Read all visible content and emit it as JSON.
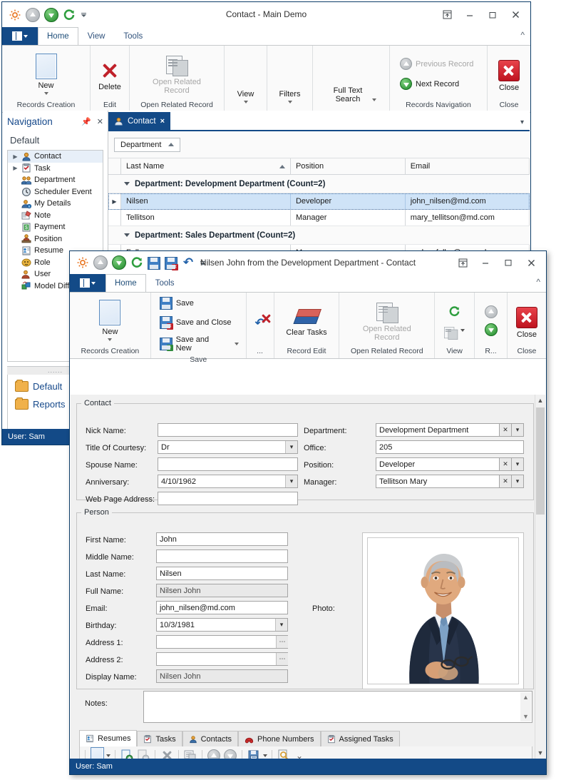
{
  "colors": {
    "accent": "#134a87",
    "titlebar_text": "#303030",
    "tab_active": "#1f4e79",
    "status_bar": "#134a87",
    "close_red": "#bf1420",
    "link_blue": "#15488a"
  },
  "window_main": {
    "title": "Contact - Main Demo",
    "quick_access": [
      "gear-icon",
      "previous-record-icon",
      "next-record-icon",
      "refresh-icon",
      "qat-dropdown-icon"
    ],
    "window_buttons": [
      "restore-ribbon-icon",
      "minimize-icon",
      "maximize-icon",
      "close-icon"
    ],
    "app_menu_label": "",
    "tabs": [
      {
        "label": "Home",
        "selected": true
      },
      {
        "label": "View",
        "selected": false
      },
      {
        "label": "Tools",
        "selected": false
      }
    ],
    "ribbon_groups": [
      {
        "label": "Records Creation",
        "items": [
          {
            "label": "New",
            "icon": "new-document-icon",
            "disabled": false,
            "has_dropdown": true
          }
        ]
      },
      {
        "label": "Edit",
        "items": [
          {
            "label": "Delete",
            "icon": "delete-x-icon",
            "disabled": false,
            "has_dropdown": false
          }
        ]
      },
      {
        "label": "Open Related Record",
        "items": [
          {
            "label": "Open Related Record",
            "icon": "open-related-record-icon",
            "disabled": true,
            "has_dropdown": false
          }
        ]
      },
      {
        "label": "",
        "items": [
          {
            "label": "View",
            "icon": "",
            "disabled": false,
            "has_dropdown": true
          }
        ]
      },
      {
        "label": "",
        "items": [
          {
            "label": "Filters",
            "icon": "",
            "disabled": false,
            "has_dropdown": true
          }
        ]
      },
      {
        "label": "",
        "items": [
          {
            "label": "Full Text Search",
            "icon": "",
            "disabled": false,
            "has_dropdown": true
          }
        ]
      },
      {
        "label": "Records Navigation",
        "items": [
          {
            "label": "Previous Record",
            "icon": "previous-record-icon",
            "disabled": true,
            "has_dropdown": false
          },
          {
            "label": "Next Record",
            "icon": "next-record-icon",
            "disabled": false,
            "has_dropdown": false
          }
        ]
      },
      {
        "label": "Close",
        "items": [
          {
            "label": "Close",
            "icon": "close-red-icon",
            "disabled": false,
            "has_dropdown": false
          }
        ]
      }
    ],
    "navigation": {
      "title": "Navigation",
      "pin_icon": "pin-icon",
      "close_icon": "close-icon",
      "section": "Default",
      "items": [
        {
          "label": "Contact",
          "icon": "contact-icon",
          "expandable": true,
          "selected": true
        },
        {
          "label": "Task",
          "icon": "task-icon",
          "expandable": true,
          "selected": false
        },
        {
          "label": "Department",
          "icon": "department-icon",
          "expandable": false,
          "selected": false
        },
        {
          "label": "Scheduler Event",
          "icon": "scheduler-event-icon",
          "expandable": false,
          "selected": false
        },
        {
          "label": "My Details",
          "icon": "my-details-icon",
          "expandable": false,
          "selected": false
        },
        {
          "label": "Note",
          "icon": "note-icon",
          "expandable": false,
          "selected": false
        },
        {
          "label": "Payment",
          "icon": "payment-icon",
          "expandable": false,
          "selected": false
        },
        {
          "label": "Position",
          "icon": "position-icon",
          "expandable": false,
          "selected": false
        },
        {
          "label": "Resume",
          "icon": "resume-icon",
          "expandable": false,
          "selected": false
        },
        {
          "label": "Role",
          "icon": "role-icon",
          "expandable": false,
          "selected": false
        },
        {
          "label": "User",
          "icon": "user-icon",
          "expandable": false,
          "selected": false
        },
        {
          "label": "Model Diff",
          "icon": "model-difference-icon",
          "expandable": false,
          "selected": false
        }
      ],
      "groups": [
        {
          "label": "Default",
          "icon": "folder-icon"
        },
        {
          "label": "Reports",
          "icon": "folder-icon"
        }
      ]
    },
    "document_tab": {
      "label": "Contact",
      "icon": "contact-icon",
      "close": "×",
      "overflow": "▾"
    },
    "group_panel": {
      "chip": "Department",
      "sort": "ascending"
    },
    "grid": {
      "columns": [
        "Last Name",
        "Position",
        "Email"
      ],
      "sorted_column": "Last Name",
      "sort_direction": "ascending",
      "rows": [
        {
          "type": "group",
          "label": "Department: Development Department (Count=2)"
        },
        {
          "type": "data",
          "selected": true,
          "cells": [
            "Nilsen",
            "Developer",
            "john_nilsen@md.com"
          ]
        },
        {
          "type": "data",
          "selected": false,
          "cells": [
            "Tellitson",
            "Manager",
            "mary_tellitson@md.com"
          ]
        },
        {
          "type": "group",
          "label": "Department: Sales Department (Count=2)"
        },
        {
          "type": "data",
          "selected": false,
          "cells": [
            "Fuller",
            "Manager",
            "andrewfuller@example.com"
          ]
        }
      ]
    },
    "status_bar": "User: Sam"
  },
  "window_detail": {
    "title": "Nilsen John from the Development Department - Contact",
    "quick_access": [
      "gear-icon",
      "previous-record-icon",
      "next-record-icon",
      "refresh-icon",
      "save-icon",
      "save-and-close-icon",
      "undo-icon",
      "qat-dropdown-icon"
    ],
    "window_buttons": [
      "restore-ribbon-icon",
      "minimize-icon",
      "maximize-icon",
      "close-icon"
    ],
    "tabs": [
      {
        "label": "Home",
        "selected": true
      },
      {
        "label": "Tools",
        "selected": false
      }
    ],
    "ribbon_groups": [
      {
        "label": "Records Creation",
        "items": [
          {
            "label": "New",
            "icon": "new-document-icon",
            "disabled": false,
            "has_dropdown": true
          }
        ]
      },
      {
        "label": "Save",
        "items": [
          {
            "label": "Save",
            "icon": "save-icon",
            "disabled": false,
            "has_dropdown": false
          },
          {
            "label": "Save and Close",
            "icon": "save-and-close-icon",
            "disabled": false,
            "has_dropdown": false
          },
          {
            "label": "Save and New",
            "icon": "save-and-new-icon",
            "disabled": false,
            "has_dropdown": true
          }
        ]
      },
      {
        "label": "...",
        "items": [
          {
            "label": "Delete",
            "icon": "delete-x-icon",
            "disabled": false,
            "has_dropdown": false
          },
          {
            "label": "Undo",
            "icon": "undo-icon",
            "disabled": false,
            "has_dropdown": false
          }
        ]
      },
      {
        "label": "Record Edit",
        "items": [
          {
            "label": "Clear Tasks",
            "icon": "eraser-icon",
            "disabled": false,
            "has_dropdown": false
          }
        ]
      },
      {
        "label": "Open Related Record",
        "items": [
          {
            "label": "Open Related Record",
            "icon": "open-related-record-icon",
            "disabled": true,
            "has_dropdown": false
          }
        ]
      },
      {
        "label": "View",
        "items": [
          {
            "label": "Refresh",
            "icon": "refresh-icon",
            "disabled": false,
            "has_dropdown": false
          },
          {
            "label": "Show Layout",
            "icon": "layout-icon",
            "disabled": true,
            "has_dropdown": true
          }
        ]
      },
      {
        "label": "R...",
        "items": [
          {
            "label": "Previous Record",
            "icon": "previous-record-icon",
            "disabled": true,
            "has_dropdown": false
          },
          {
            "label": "Next Record",
            "icon": "next-record-icon",
            "disabled": false,
            "has_dropdown": false
          }
        ]
      },
      {
        "label": "Close",
        "items": [
          {
            "label": "Close",
            "icon": "close-red-icon",
            "disabled": false,
            "has_dropdown": false
          }
        ]
      }
    ],
    "contact_group": {
      "legend": "Contact",
      "fields_left": [
        {
          "label": "Nick Name:",
          "value": "",
          "type": "text"
        },
        {
          "label": "Title Of Courtesy:",
          "value": "Dr",
          "type": "combo"
        },
        {
          "label": "Spouse Name:",
          "value": "",
          "type": "text"
        },
        {
          "label": "Anniversary:",
          "value": "4/10/1962",
          "type": "combo"
        },
        {
          "label": "Web Page Address:",
          "value": "",
          "type": "text"
        }
      ],
      "fields_right": [
        {
          "label": "Department:",
          "value": "Development Department",
          "type": "lookup"
        },
        {
          "label": "Office:",
          "value": "205",
          "type": "text"
        },
        {
          "label": "Position:",
          "value": "Developer",
          "type": "lookup"
        },
        {
          "label": "Manager:",
          "value": "Tellitson Mary",
          "type": "lookup"
        }
      ]
    },
    "person_group": {
      "legend": "Person",
      "fields": [
        {
          "label": "First Name:",
          "value": "John",
          "type": "text",
          "readonly": false
        },
        {
          "label": "Middle Name:",
          "value": "",
          "type": "text",
          "readonly": false
        },
        {
          "label": "Last Name:",
          "value": "Nilsen",
          "type": "text",
          "readonly": false
        },
        {
          "label": "Full Name:",
          "value": "Nilsen John",
          "type": "text",
          "readonly": true
        },
        {
          "label": "Email:",
          "value": "john_nilsen@md.com",
          "type": "text",
          "readonly": false
        },
        {
          "label": "Birthday:",
          "value": "10/3/1981",
          "type": "combo",
          "readonly": false
        },
        {
          "label": "Address 1:",
          "value": "",
          "type": "ellipsis",
          "readonly": false
        },
        {
          "label": "Address 2:",
          "value": "",
          "type": "ellipsis",
          "readonly": false
        },
        {
          "label": "Display Name:",
          "value": "Nilsen John",
          "type": "text",
          "readonly": true
        }
      ],
      "photo_label": "Photo:",
      "photo_alt": "portrait of a smiling man in a dark navy suit holding glasses"
    },
    "notes": {
      "label": "Notes:",
      "value": ""
    },
    "detail_tabs": [
      {
        "label": "Resumes",
        "icon": "resume-icon",
        "selected": true
      },
      {
        "label": "Tasks",
        "icon": "task-icon",
        "selected": false
      },
      {
        "label": "Contacts",
        "icon": "contact-icon",
        "selected": false
      },
      {
        "label": "Phone Numbers",
        "icon": "phone-icon",
        "selected": false
      },
      {
        "label": "Assigned Tasks",
        "icon": "assigned-task-icon",
        "selected": false
      }
    ],
    "detail_toolbar": [
      {
        "name": "new-button",
        "icon": "new-document-icon",
        "disabled": false,
        "has_dropdown": true
      },
      {
        "name": "link-button",
        "icon": "add-link-icon",
        "disabled": false,
        "has_dropdown": false
      },
      {
        "name": "unlink-button",
        "icon": "remove-link-icon",
        "disabled": true,
        "has_dropdown": false
      },
      {
        "name": "delete-button",
        "icon": "delete-x-icon",
        "disabled": true,
        "has_dropdown": false
      },
      {
        "name": "inline-edit-button",
        "icon": "inline-edit-icon",
        "disabled": false,
        "has_dropdown": false
      },
      {
        "name": "move-up-button",
        "icon": "move-up-icon",
        "disabled": true,
        "has_dropdown": false
      },
      {
        "name": "move-down-button",
        "icon": "move-down-icon",
        "disabled": true,
        "has_dropdown": false
      },
      {
        "name": "export-button",
        "icon": "export-icon",
        "disabled": false,
        "has_dropdown": true
      },
      {
        "name": "find-button",
        "icon": "find-icon",
        "disabled": false,
        "has_dropdown": true
      }
    ],
    "status_bar": "User: Sam"
  }
}
